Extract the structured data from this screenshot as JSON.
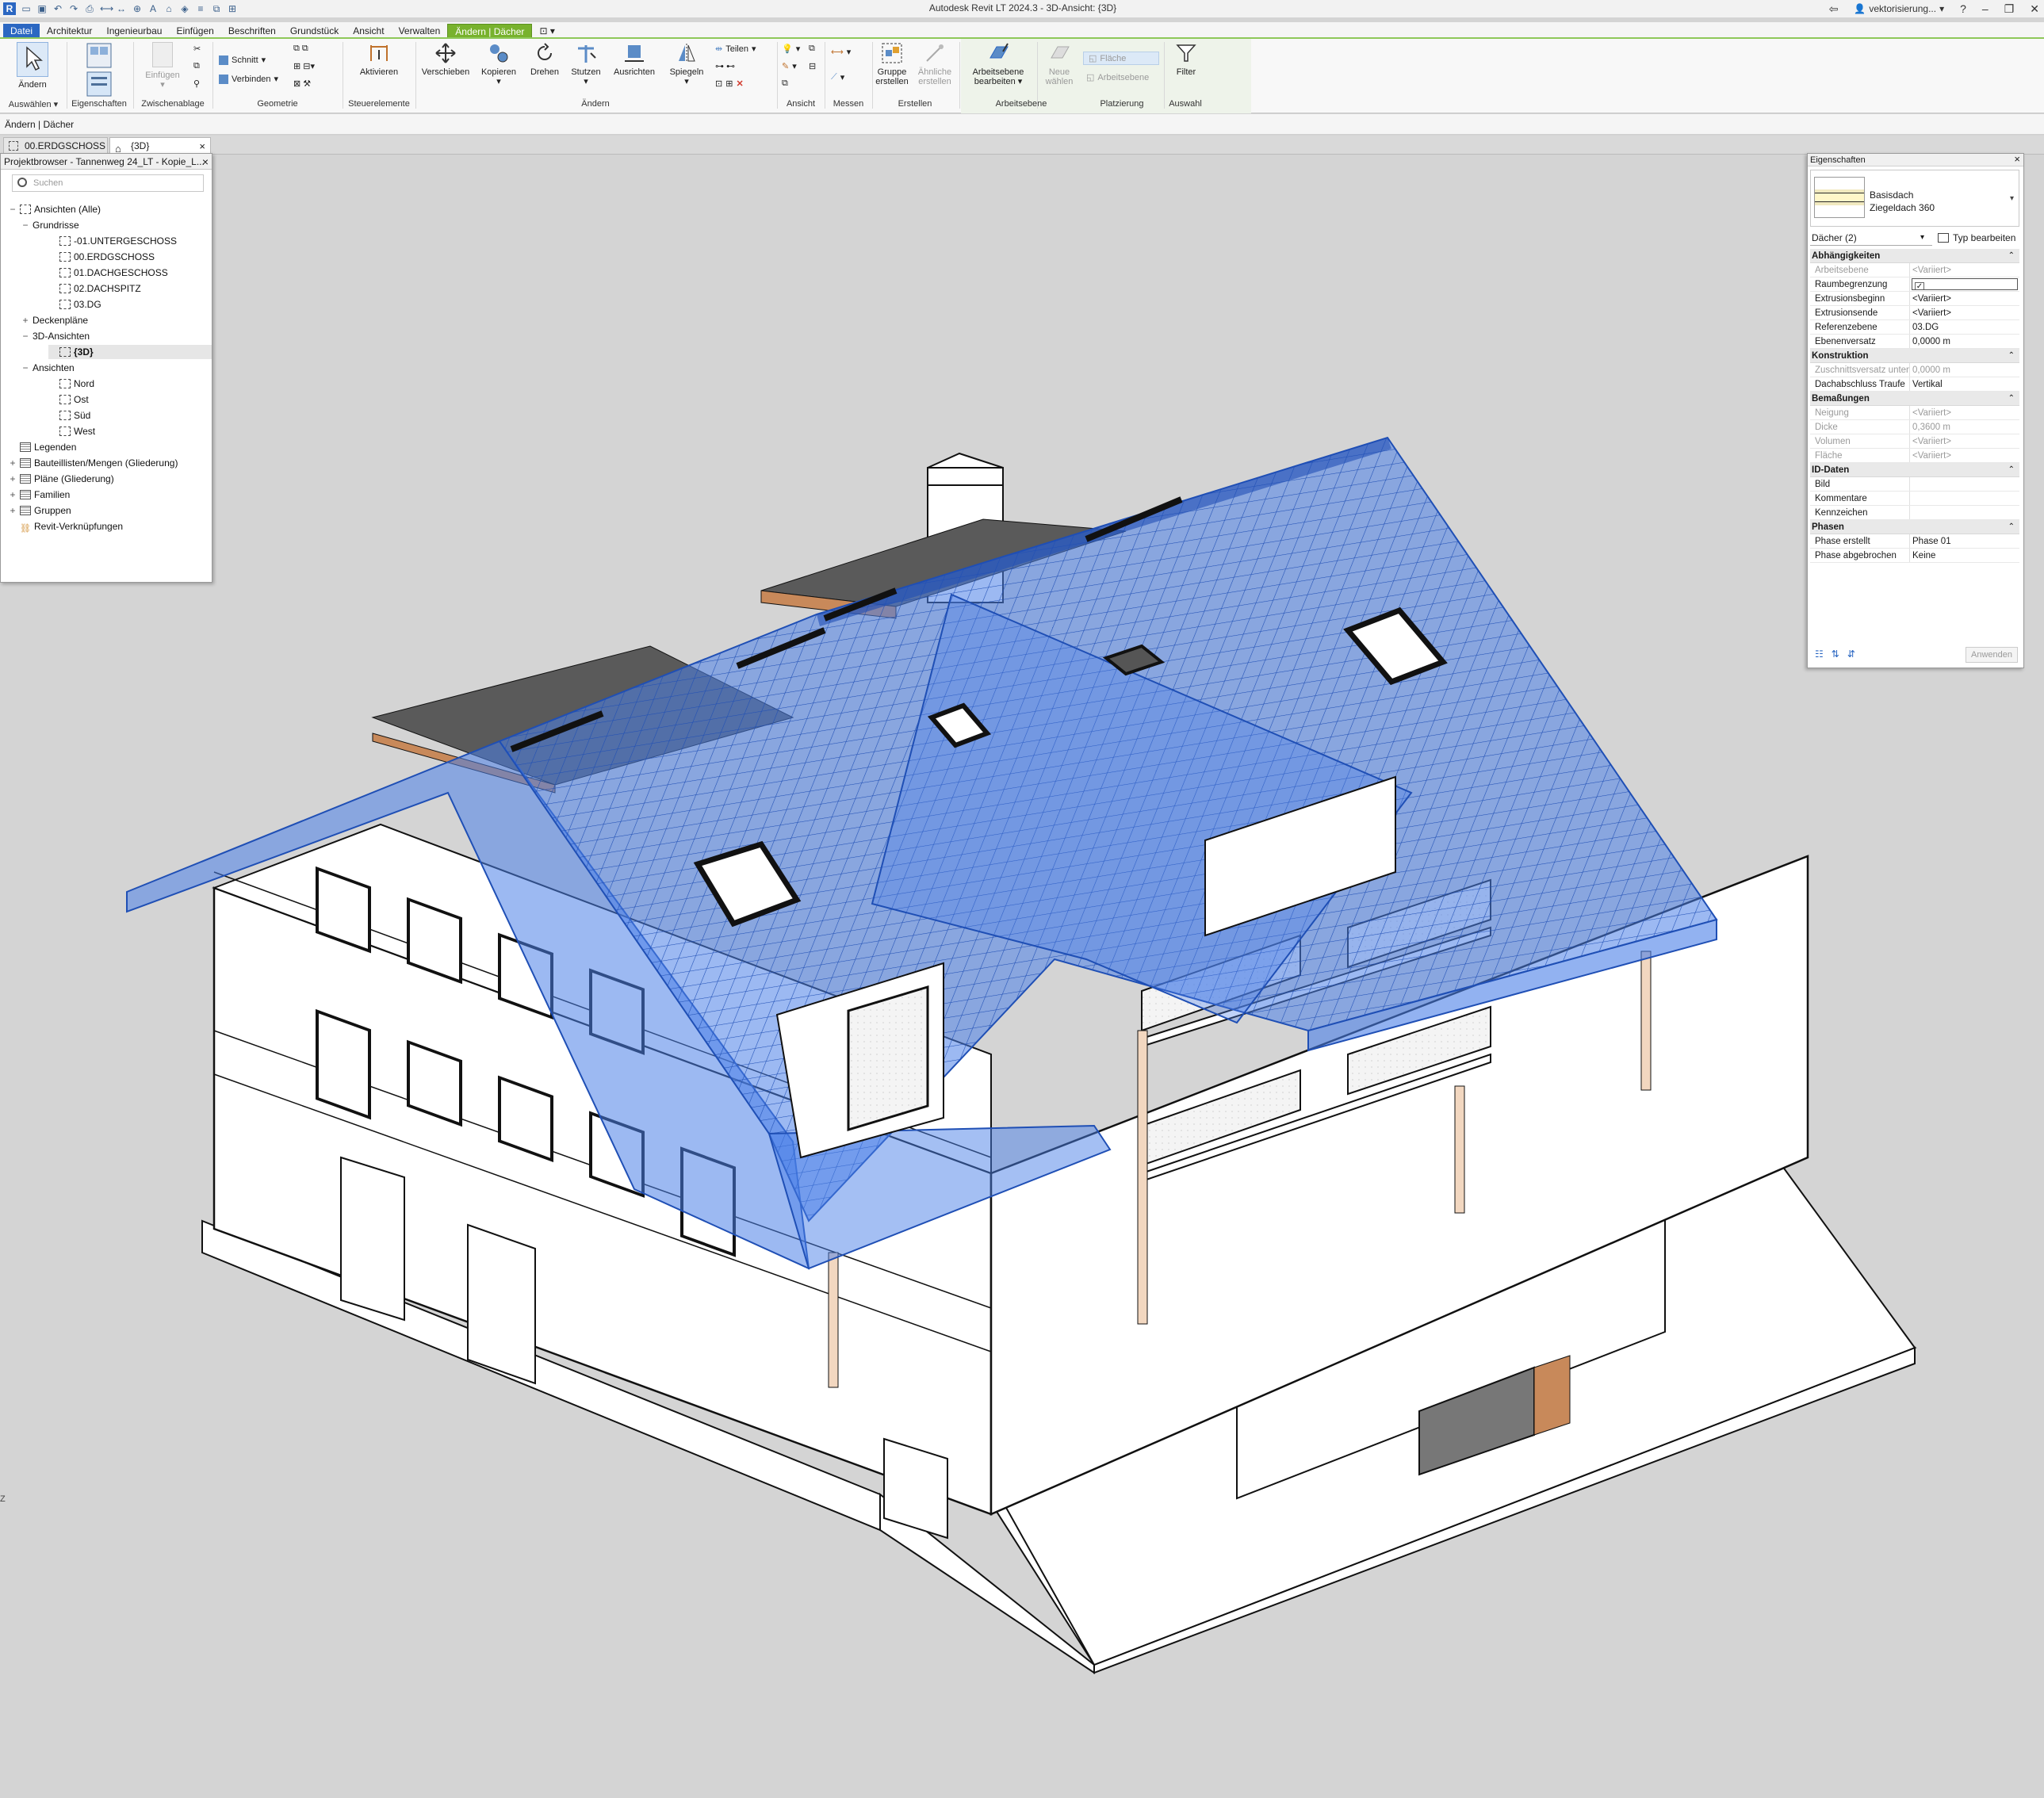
{
  "app": {
    "title": "Autodesk Revit LT 2024.3 - 3D-Ansicht: {3D}",
    "logo_letter": "R",
    "user": "vektorisierung...",
    "help": "?"
  },
  "menu_tabs": [
    "Datei",
    "Architektur",
    "Ingenieurbau",
    "Einfügen",
    "Beschriften",
    "Grundstück",
    "Ansicht",
    "Verwalten",
    "Ändern | Dächer"
  ],
  "ribbon": {
    "aendern": "Ändern",
    "auswaehlen": "Auswählen",
    "eigenschaften": "Eigenschaften",
    "einfuegen": "Einfügen",
    "zwischenablage": "Zwischenablage",
    "schnitt": "Schnitt",
    "verbinden": "Verbinden",
    "geometrie": "Geometrie",
    "aktivieren": "Aktivieren",
    "steuerelemente": "Steuerelemente",
    "verschieben": "Verschieben",
    "kopieren": "Kopieren",
    "drehen": "Drehen",
    "stutzen": "Stutzen",
    "ausrichten": "Ausrichten",
    "spiegeln": "Spiegeln",
    "teilen": "Teilen",
    "aendern_panel": "Ändern",
    "ansicht": "Ansicht",
    "messen": "Messen",
    "gruppe1": "Gruppe",
    "gruppe2": "erstellen",
    "aehnliche1": "Ähnliche",
    "aehnliche2": "erstellen",
    "erstellen": "Erstellen",
    "arbeitsebene_btn1": "Arbeitsebene",
    "arbeitsebene_btn2": "bearbeiten",
    "neue1": "Neue",
    "neue2": "wählen",
    "flaeche": "Fläche",
    "arbeitsebene_small": "Arbeitsebene",
    "arbeitsebene_panel": "Arbeitsebene",
    "platzierung": "Platzierung",
    "filter": "Filter",
    "auswahl": "Auswahl"
  },
  "options_bar": "Ändern | Dächer",
  "view_tabs": [
    {
      "label": "00.ERDGSCHOSS"
    },
    {
      "label": "{3D}",
      "close": "×"
    }
  ],
  "project_browser": {
    "title": "Projektbrowser - Tannenweg 24_LT - Kopie_L...",
    "close": "×",
    "search_placeholder": "Suchen",
    "tree": [
      {
        "label": "Ansichten (Alle)",
        "exp": "−"
      },
      {
        "label": "Grundrisse",
        "exp": "−"
      },
      {
        "label": "-01.UNTERGESCHOSS"
      },
      {
        "label": "00.ERDGSCHOSS"
      },
      {
        "label": "01.DACHGESCHOSS"
      },
      {
        "label": "02.DACHSPITZ"
      },
      {
        "label": "03.DG"
      },
      {
        "label": "Deckenpläne",
        "exp": "+"
      },
      {
        "label": "3D-Ansichten",
        "exp": "−"
      },
      {
        "label": "{3D}"
      },
      {
        "label": "Ansichten",
        "exp": "−"
      },
      {
        "label": "Nord"
      },
      {
        "label": "Ost"
      },
      {
        "label": "Süd"
      },
      {
        "label": "West"
      },
      {
        "label": "Legenden"
      },
      {
        "label": "Bauteillisten/Mengen (Gliederung)",
        "exp": "+"
      },
      {
        "label": "Pläne (Gliederung)",
        "exp": "+"
      },
      {
        "label": "Familien",
        "exp": "+"
      },
      {
        "label": "Gruppen",
        "exp": "+"
      },
      {
        "label": "Revit-Verknüpfungen"
      }
    ]
  },
  "properties": {
    "title": "Eigenschaften",
    "close": "×",
    "type_line1": "Basisdach",
    "type_line2": "Ziegeldach 360",
    "filter": "Dächer (2)",
    "edit_type": "Typ bearbeiten",
    "apply": "Anwenden",
    "groups": {
      "abhaengigkeiten": "Abhängigkeiten",
      "konstruktion": "Konstruktion",
      "bemassungen": "Bemaßungen",
      "id_daten": "ID-Daten",
      "phasen": "Phasen"
    },
    "rows": {
      "arbeitsebene": {
        "k": "Arbeitsebene",
        "v": "<Variiert>"
      },
      "raumbegrenzung": {
        "k": "Raumbegrenzung",
        "v": "✓"
      },
      "extrusionsbeginn": {
        "k": "Extrusionsbeginn",
        "v": "<Variiert>"
      },
      "extrusionsende": {
        "k": "Extrusionsende",
        "v": "<Variiert>"
      },
      "referenzebene": {
        "k": "Referenzebene",
        "v": "03.DG"
      },
      "ebenenversatz": {
        "k": "Ebenenversatz",
        "v": "0,0000 m"
      },
      "zuschnitt": {
        "k": "Zuschnittsversatz unten",
        "v": "0,0000 m"
      },
      "dachabschluss": {
        "k": "Dachabschluss Traufe",
        "v": "Vertikal"
      },
      "neigung": {
        "k": "Neigung",
        "v": "<Variiert>"
      },
      "dicke": {
        "k": "Dicke",
        "v": "0,3600 m"
      },
      "volumen": {
        "k": "Volumen",
        "v": "<Variiert>"
      },
      "flaeche": {
        "k": "Fläche",
        "v": "<Variiert>"
      },
      "bild": {
        "k": "Bild",
        "v": ""
      },
      "kommentare": {
        "k": "Kommentare",
        "v": ""
      },
      "kennzeichen": {
        "k": "Kennzeichen",
        "v": ""
      },
      "phase_erstellt": {
        "k": "Phase erstellt",
        "v": "Phase 01"
      },
      "phase_abgebrochen": {
        "k": "Phase abgebrochen",
        "v": "Keine"
      }
    }
  },
  "viewport": {
    "left_marker": "Z"
  },
  "colors": {
    "file_tab": "#2b67c2",
    "context_tab": "#78b22d",
    "roof_selection": "#4a7fe8",
    "viewport_bg": "#d4d4d4"
  }
}
